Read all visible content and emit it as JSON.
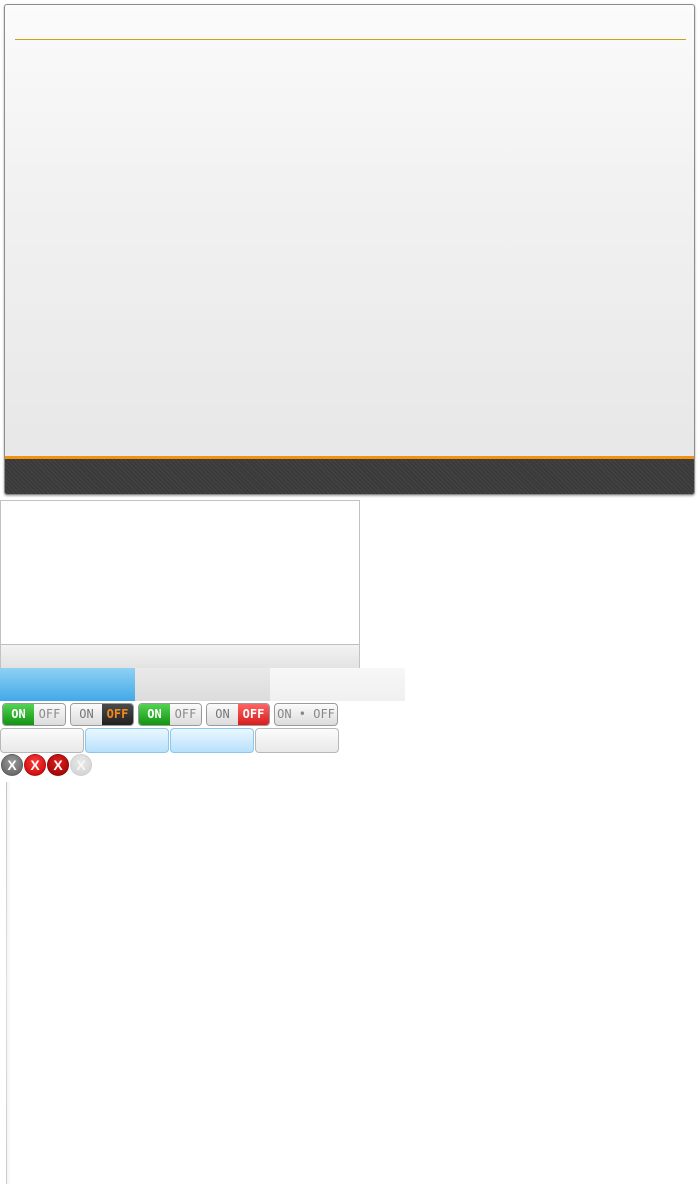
{
  "toggles": [
    {
      "on": "ON",
      "off": "OFF",
      "state": "on",
      "style": "green"
    },
    {
      "on": "ON",
      "off": "OFF",
      "state": "off",
      "style": "dark"
    },
    {
      "on": "ON",
      "off": "OFF",
      "state": "on",
      "style": "green"
    },
    {
      "on": "ON",
      "off": "OFF",
      "state": "off",
      "style": "red"
    },
    {
      "label": "ON • OFF",
      "state": "disabled"
    }
  ],
  "close_buttons": [
    {
      "glyph": "X",
      "color": "#7a7a7a"
    },
    {
      "glyph": "X",
      "color": "#e01010"
    },
    {
      "glyph": "X",
      "color": "#b80000"
    },
    {
      "glyph": "X",
      "color": "#dddddd"
    }
  ],
  "segments": [
    {
      "state": "active",
      "color": "#41a9e8"
    },
    {
      "state": "inactive",
      "color": "#e2e2e2"
    },
    {
      "state": "inactive",
      "color": "#f3f3f3"
    }
  ],
  "colors": {
    "accent_orange": "#f39212",
    "rule_gold": "#c9a318",
    "footer_dark": "#3a3a3a",
    "segment_blue": "#41a9e8",
    "toggle_green": "#129412",
    "toggle_red": "#d81c1c"
  }
}
